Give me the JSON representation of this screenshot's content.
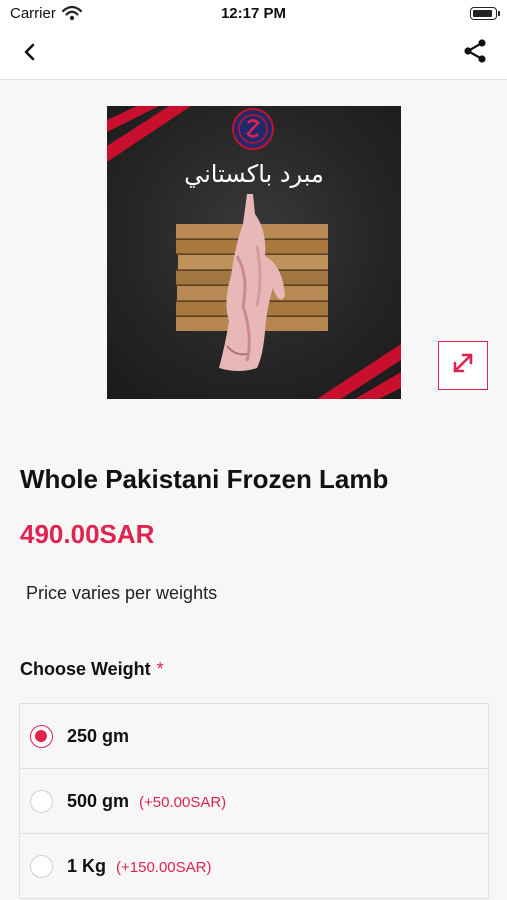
{
  "status_bar": {
    "carrier": "Carrier",
    "time": "12:17 PM"
  },
  "nav": {
    "back_icon": "chevron-left-icon",
    "share_icon": "share-icon"
  },
  "product": {
    "image_text": "مبرد باكستاني",
    "name": "Whole Pakistani Frozen Lamb",
    "price": "490.00SAR",
    "price_note": "Price varies per weights",
    "expand_icon": "expand-arrows-icon"
  },
  "weight_section": {
    "label": "Choose Weight",
    "required_marker": "*",
    "options": [
      {
        "label": "250 gm",
        "extra": "",
        "selected": true
      },
      {
        "label": "500 gm",
        "extra": "(+50.00SAR)",
        "selected": false
      },
      {
        "label": "1 Kg",
        "extra": "(+150.00SAR)",
        "selected": false
      }
    ]
  },
  "colors": {
    "accent": "#e0234f",
    "background": "#f7f7f7",
    "text": "#111111"
  }
}
